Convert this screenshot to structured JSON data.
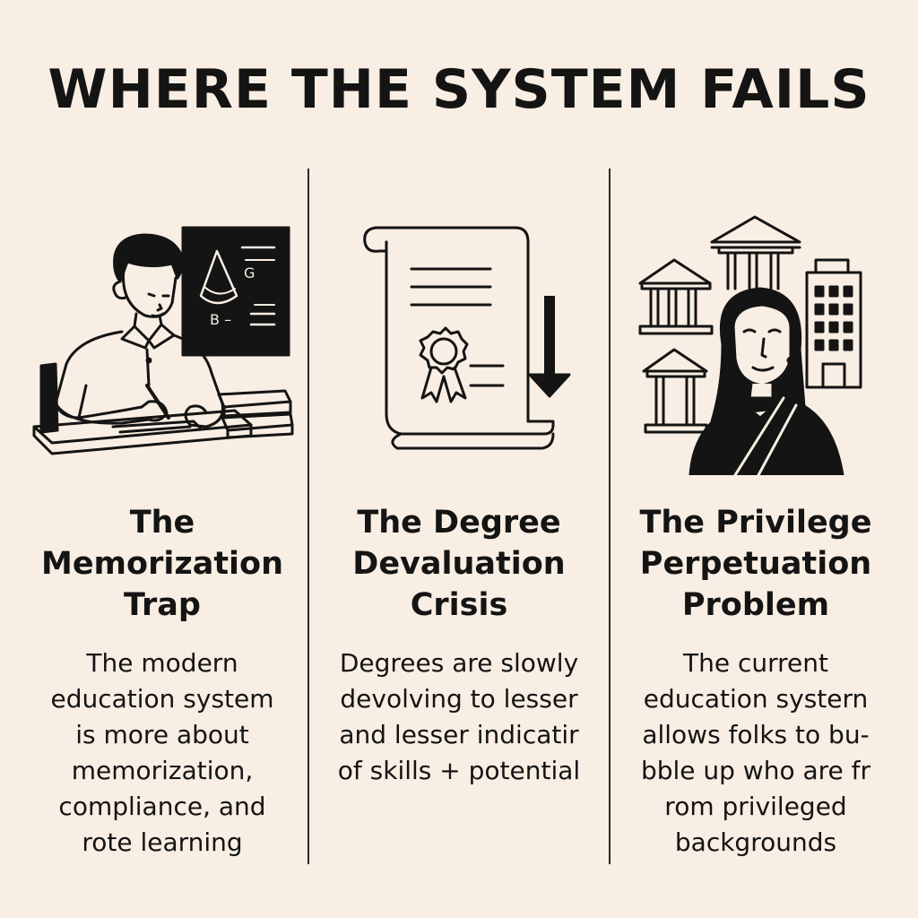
{
  "title": "WHERE THE SYSTEM FAILS",
  "columns": [
    {
      "heading_lines": [
        "The",
        "Memorization",
        "Trap"
      ],
      "body_lines": [
        "The modern",
        "education system",
        "is more about",
        "memorization,",
        "compliance, and",
        "rote learning"
      ],
      "chalkboard_labels": [
        "G",
        "B –"
      ]
    },
    {
      "heading_lines": [
        "The Degree",
        "Devaluation",
        "Crisis"
      ],
      "body_lines": [
        "Degrees are slowly",
        "devolving to lesser",
        "and lesser indicatir",
        "of skills + potential"
      ]
    },
    {
      "heading_lines": [
        "The Privilege",
        "Perpetuation",
        "Problem"
      ],
      "body_lines": [
        "The current",
        "education systern",
        "allows folks to bu-",
        "bble up who are fr",
        "rom privileged",
        "backgrounds"
      ]
    }
  ],
  "colors": {
    "background": "#f9eee3",
    "ink": "#141414"
  },
  "icons": [
    "student-at-desk-illustration",
    "chalkboard-icon",
    "diploma-scroll-icon",
    "award-ribbon-icon",
    "down-arrow-icon",
    "classical-building-icon",
    "office-building-icon",
    "woman-portrait-illustration"
  ]
}
